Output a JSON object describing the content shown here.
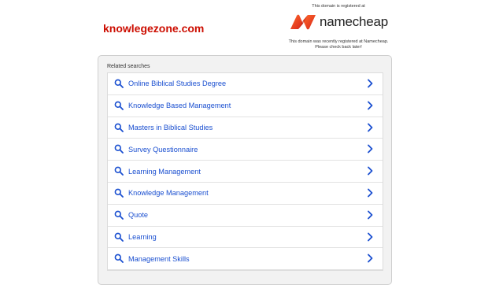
{
  "header": {
    "domain": "knowlegezone.com"
  },
  "registrar": {
    "top_text": "This domain is registered at",
    "brand": "namecheap",
    "note_line1": "This domain was recently registered at Namecheap.",
    "note_line2": "Please check back later!"
  },
  "related": {
    "label": "Related searches",
    "items": [
      {
        "label": "Online Biblical Studies Degree"
      },
      {
        "label": "Knowledge Based Management"
      },
      {
        "label": "Masters in Biblical Studies"
      },
      {
        "label": "Survey Questionnaire"
      },
      {
        "label": "Learning Management"
      },
      {
        "label": "Knowledge Management"
      },
      {
        "label": "Quote"
      },
      {
        "label": "Learning"
      },
      {
        "label": "Management Skills"
      }
    ]
  },
  "colors": {
    "domain_red": "#cc0d00",
    "link_blue": "#1a4fd0",
    "brand_orange": "#e8502b"
  }
}
